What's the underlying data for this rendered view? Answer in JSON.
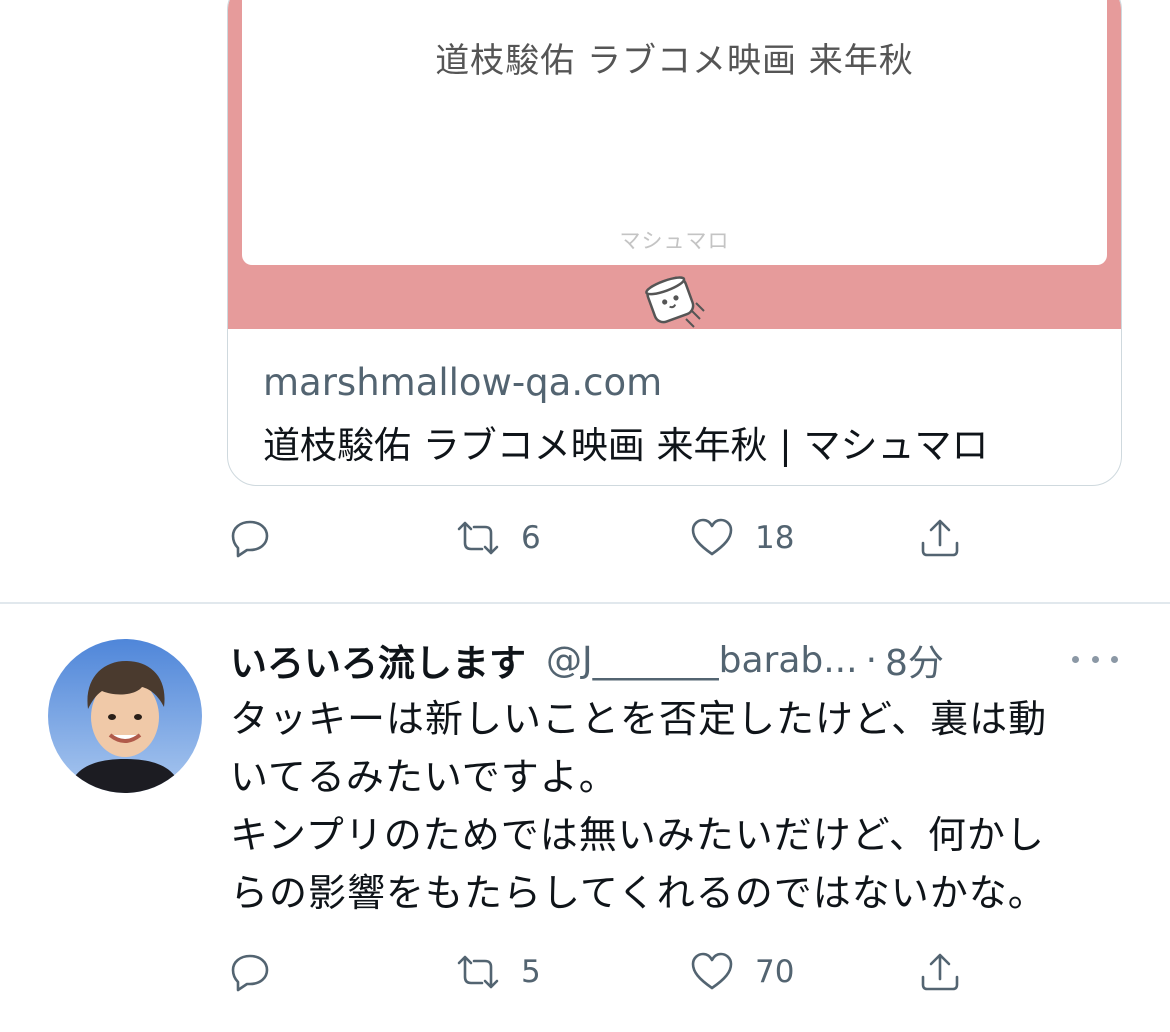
{
  "card": {
    "question_text": "道枝駿佑 ラブコメ映画 来年秋",
    "brand_label": "マシュマロ",
    "domain": "marshmallow-qa.com",
    "title": "道枝駿佑 ラブコメ映画 来年秋 | マシュマロ",
    "media_color": "#e69b9b"
  },
  "tweet1": {
    "actions": {
      "reply_icon": "reply-icon",
      "retweet_count": "6",
      "like_count": "18",
      "share_icon": "share-icon"
    }
  },
  "tweet2": {
    "display_name": "いろいろ流します",
    "handle": "@J_______barab...",
    "separator": "·",
    "time": "8分",
    "text": "タッキーは新しいことを否定したけど、裏は動\nいてるみたいですよ。\nキンプリのためでは無いみたいだけど、何かし\nらの影響をもたらしてくれるのではないかな。",
    "actions": {
      "retweet_count": "5",
      "like_count": "70"
    }
  },
  "colors": {
    "secondary_text": "#536471",
    "divider": "#e1e8ed",
    "card_border": "#cfd9de"
  }
}
